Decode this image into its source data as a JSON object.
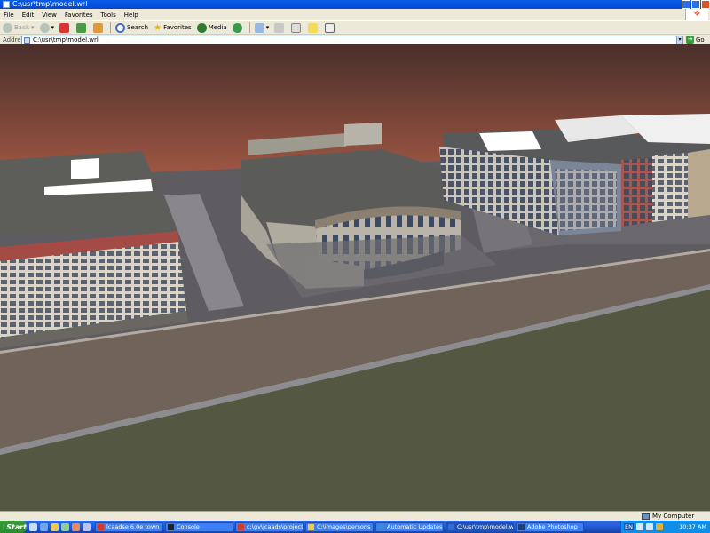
{
  "window": {
    "title": "C:\\usr\\tmp\\model.wrl"
  },
  "menu": [
    "File",
    "Edit",
    "View",
    "Favorites",
    "Tools",
    "Help"
  ],
  "toolbar": {
    "back": "Back",
    "search": "Search",
    "favorites": "Favorites",
    "media": "Media"
  },
  "address": {
    "label": "Address",
    "value": "C:\\usr\\tmp\\model.wrl",
    "go": "Go"
  },
  "status": {
    "zone": "My Computer"
  },
  "taskbar": {
    "start": "Start",
    "tasks": [
      {
        "label": "lcaadse 6.0e town",
        "icon_color": "#d23a2a"
      },
      {
        "label": "Console",
        "icon_color": "#222222"
      },
      {
        "label": "c:\\gv\\jcaads\\projects\\K...",
        "icon_color": "#d23a2a"
      },
      {
        "label": "C:\\images\\persons",
        "icon_color": "#f3c84b"
      },
      {
        "label": "Automatic Updates",
        "icon_color": "#3a8ad6"
      },
      {
        "label": "C:\\usr\\tmp\\model.wrl",
        "icon_color": "#2f6fd3"
      },
      {
        "label": "Adobe Photoshop",
        "icon_color": "#1d3f7a"
      }
    ],
    "tray": {
      "lang": "EN",
      "clock": "10:37 AM"
    }
  },
  "scene": {
    "sky_top": "#4a2f2b",
    "sky_bottom": "#a65a45",
    "grass": "#545842",
    "sidewalk": "#6f635a",
    "asphalt": "#5e5c60"
  }
}
